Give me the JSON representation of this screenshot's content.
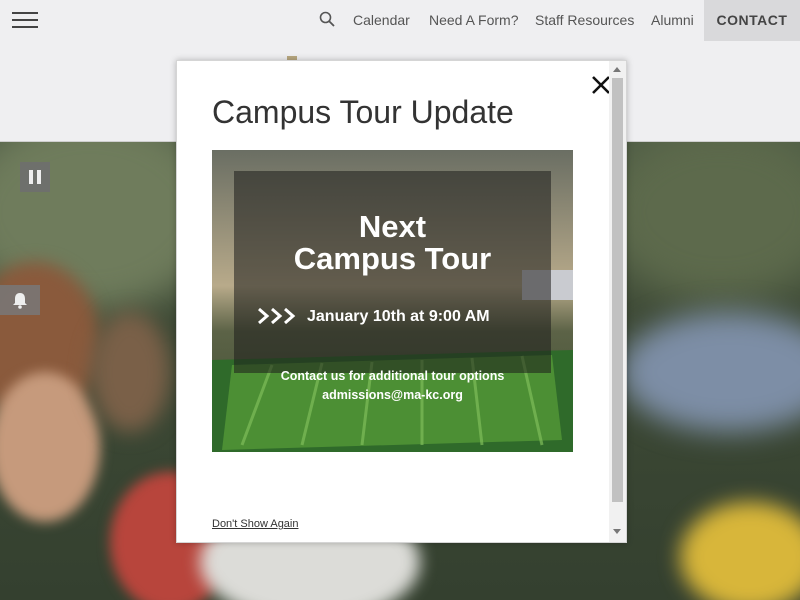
{
  "nav": {
    "links": [
      {
        "label": "Calendar"
      },
      {
        "label": "Need A Form?"
      },
      {
        "label": "Staff Resources"
      },
      {
        "label": "Alumni"
      }
    ],
    "contact_label": "CONTACT",
    "icons": {
      "menu": "hamburger-icon",
      "search": "search-icon"
    }
  },
  "hero_controls": {
    "pause": "pause-icon",
    "notify": "bell-icon"
  },
  "modal": {
    "title": "Campus Tour Update",
    "close_icon": "close-icon",
    "flyer": {
      "heading_line1": "Next",
      "heading_line2": "Campus Tour",
      "date": "January 10th at 9:00 AM",
      "contact_line": "Contact us for additional tour options",
      "email": "admissions@ma-kc.org"
    },
    "dont_show_label": "Don't Show Again"
  }
}
